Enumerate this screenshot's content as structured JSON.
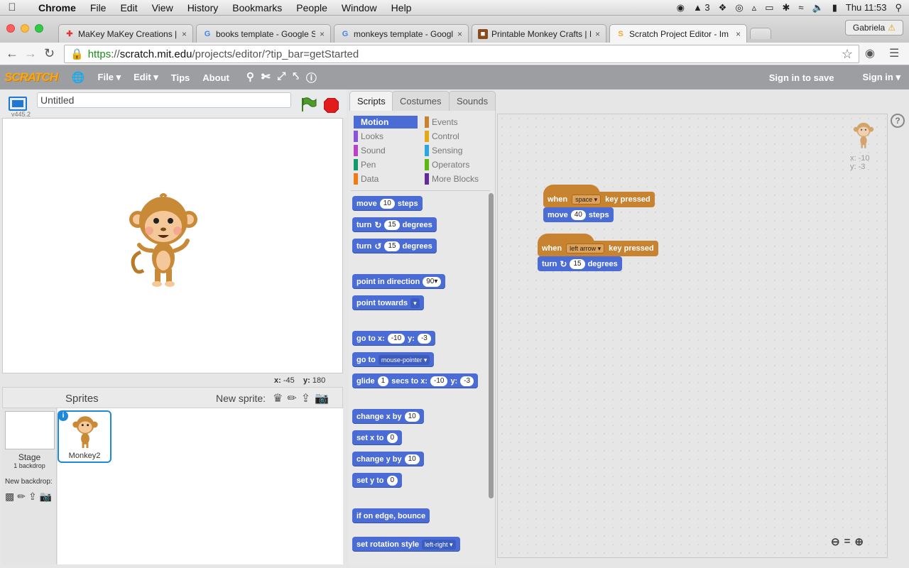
{
  "os": {
    "app": "Chrome",
    "menus": [
      "File",
      "Edit",
      "View",
      "History",
      "Bookmarks",
      "People",
      "Window",
      "Help"
    ],
    "status_count": "3",
    "clock": "Thu 11:53"
  },
  "browser": {
    "tabs": [
      {
        "title": "MaKey MaKey Creations | A",
        "favicon": "makey-icon"
      },
      {
        "title": "books template - Google S",
        "favicon": "google-icon"
      },
      {
        "title": "monkeys template - Googl",
        "favicon": "google-icon"
      },
      {
        "title": "Printable Monkey Crafts | I",
        "favicon": "craft-icon"
      },
      {
        "title": "Scratch Project Editor - Im",
        "favicon": "scratch-icon"
      }
    ],
    "profile": "Gabriela",
    "url_scheme": "https",
    "url_sep": "://",
    "url_host": "scratch.mit.edu",
    "url_path": "/projects/editor/?tip_bar=getStarted"
  },
  "scratch": {
    "logo": "SCRATCH",
    "nav": [
      "File",
      "Edit",
      "Tips",
      "About"
    ],
    "sign_in_save": "Sign in to save",
    "sign_in": "Sign in",
    "version": "v445.2",
    "project_title": "Untitled",
    "mouse_x_label": "x:",
    "mouse_x": "-45",
    "mouse_y_label": "y:",
    "mouse_y": "180",
    "sprites_label": "Sprites",
    "new_sprite_label": "New sprite:",
    "stage_label": "Stage",
    "stage_backdrops": "1 backdrop",
    "new_backdrop_label": "New backdrop:",
    "sprite_name": "Monkey2",
    "editor_tabs": [
      "Scripts",
      "Costumes",
      "Sounds"
    ],
    "categories": [
      {
        "label": "Motion",
        "color": "#4a6cd4"
      },
      {
        "label": "Events",
        "color": "#c88330"
      },
      {
        "label": "Looks",
        "color": "#8a55d7"
      },
      {
        "label": "Control",
        "color": "#e1a91a"
      },
      {
        "label": "Sound",
        "color": "#bb42c3"
      },
      {
        "label": "Sensing",
        "color": "#2ca5e2"
      },
      {
        "label": "Pen",
        "color": "#0e9a6c"
      },
      {
        "label": "Operators",
        "color": "#5cb712"
      },
      {
        "label": "Data",
        "color": "#ee7d16"
      },
      {
        "label": "More Blocks",
        "color": "#632d99"
      }
    ],
    "blocks": {
      "move": {
        "a": "move",
        "n": "10",
        "b": "steps"
      },
      "turn_cw": {
        "a": "turn",
        "n": "15",
        "b": "degrees"
      },
      "turn_ccw": {
        "a": "turn",
        "n": "15",
        "b": "degrees"
      },
      "point_dir": {
        "a": "point in direction",
        "n": "90▾"
      },
      "point_towards": {
        "a": "point towards",
        "d": "▾"
      },
      "goto_xy": {
        "a": "go to x:",
        "n1": "-10",
        "b": "y:",
        "n2": "-3"
      },
      "goto": {
        "a": "go to",
        "d": "mouse-pointer ▾"
      },
      "glide": {
        "a": "glide",
        "n1": "1",
        "b": "secs to x:",
        "n2": "-10",
        "c": "y:",
        "n3": "-3"
      },
      "change_x": {
        "a": "change x by",
        "n": "10"
      },
      "set_x": {
        "a": "set x to",
        "n": "0"
      },
      "change_y": {
        "a": "change y by",
        "n": "10"
      },
      "set_y": {
        "a": "set y to",
        "n": "0"
      },
      "bounce": {
        "a": "if on edge, bounce"
      },
      "rotation": {
        "a": "set rotation style",
        "d": "left-right ▾"
      }
    },
    "sprite_x_label": "x:",
    "sprite_x": "-10",
    "sprite_y_label": "y:",
    "sprite_y": "-3",
    "scripts": [
      {
        "hat_a": "when",
        "key": "space ▾",
        "hat_b": "key pressed",
        "cmd": "move",
        "n": "40",
        "cmd_b": "steps"
      },
      {
        "hat_a": "when",
        "key": "left arrow ▾",
        "hat_b": "key pressed",
        "cmd": "turn",
        "n": "15",
        "cmd_b": "degrees"
      }
    ]
  }
}
